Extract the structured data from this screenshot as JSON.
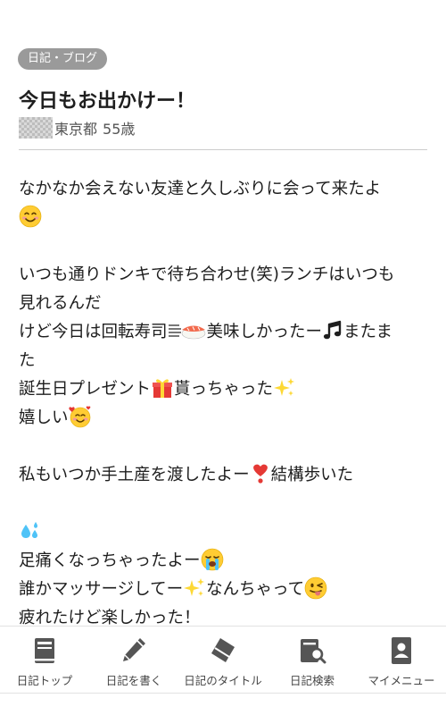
{
  "post": {
    "category": "日記・ブログ",
    "title": "今日もお出かけー！",
    "author_location": "東京都",
    "author_age": "55歳",
    "body": {
      "p1_l1": "なかなか会えない友達と久しぶりに会って来たよ",
      "p2_l1": "いつも通りドンキで待ち合わせ(笑)ランチはいつも",
      "p2_l2": "見れるんだ",
      "p2_l3_a": "けど今日は回転寿司",
      "p2_l3_b": "美味しかったー",
      "p2_l3_c": "またま",
      "p2_l4": "た",
      "p2_l5_a": "誕生日プレゼント",
      "p2_l5_b": "貰っちゃった",
      "p2_l6": "嬉しい",
      "p3_l1_a": "私もいつか手土産を渡したよー",
      "p3_l1_b": "結構歩いた",
      "p4_l2": "足痛くなっちゃったよー",
      "p4_l3_a": "誰かマッサージしてー",
      "p4_l3_b": "なんちゃって",
      "p4_l4": "疲れたけど楽しかった！"
    }
  },
  "nav": {
    "items": [
      {
        "label": "日記トップ",
        "icon": "book-icon"
      },
      {
        "label": "日記を書く",
        "icon": "pencil-icon"
      },
      {
        "label": "日記のタイトル",
        "icon": "eraser-icon"
      },
      {
        "label": "日記検索",
        "icon": "search-book-icon"
      },
      {
        "label": "マイメニュー",
        "icon": "profile-card-icon"
      }
    ]
  },
  "colors": {
    "badge_bg": "#9a9a9a",
    "text": "#1e1e1e",
    "icon": "#555555"
  }
}
